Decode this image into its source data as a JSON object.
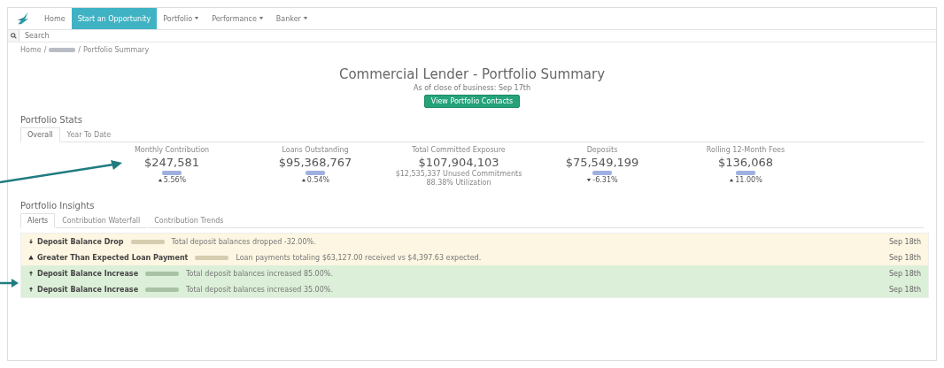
{
  "nav": {
    "items": [
      {
        "label": "Home",
        "selected": false,
        "dropdown": false
      },
      {
        "label": "Start an Opportunity",
        "selected": true,
        "dropdown": false
      },
      {
        "label": "Portfolio",
        "selected": false,
        "dropdown": true
      },
      {
        "label": "Performance",
        "selected": false,
        "dropdown": true
      },
      {
        "label": "Banker",
        "selected": false,
        "dropdown": true
      }
    ]
  },
  "search": {
    "placeholder": "Search"
  },
  "breadcrumb": {
    "first": "Home",
    "separator": "/",
    "last": "Portfolio Summary"
  },
  "header": {
    "title": "Commercial Lender - Portfolio Summary",
    "subtitle": "As of close of business: Sep 17th",
    "button": "View Portfolio Contacts"
  },
  "stats": {
    "heading": "Portfolio Stats",
    "tabs": [
      {
        "label": "Overall",
        "selected": true
      },
      {
        "label": "Year To Date",
        "selected": false
      }
    ],
    "items": [
      {
        "label": "Monthly Contribution",
        "value": "$247,581",
        "kind": "up",
        "change": "5.56%"
      },
      {
        "label": "Loans Outstanding",
        "value": "$95,368,767",
        "kind": "up",
        "change": "0.54%"
      },
      {
        "label": "Total Committed Exposure",
        "value": "$107,904,103",
        "kind": "notes",
        "notes": [
          "$12,535,337 Unused Commitments",
          "88.38% Utilization"
        ]
      },
      {
        "label": "Deposits",
        "value": "$75,549,199",
        "kind": "down",
        "change": "-6.31%"
      },
      {
        "label": "Rolling 12-Month Fees",
        "value": "$136,068",
        "kind": "up",
        "change": "11.00%"
      }
    ]
  },
  "insights": {
    "heading": "Portfolio Insights",
    "tabs": [
      {
        "label": "Alerts",
        "selected": true
      },
      {
        "label": "Contribution Waterfall",
        "selected": false
      },
      {
        "label": "Contribution Trends",
        "selected": false
      }
    ],
    "alerts": [
      {
        "kind": "drop",
        "title": "Deposit Balance Drop",
        "message": "Total deposit balances dropped -32.00%.",
        "date": "Sep 18th"
      },
      {
        "kind": "payment",
        "title": "Greater Than Expected Loan Payment",
        "message": "Loan payments totaling $63,127.00 received vs $4,397.63 expected.",
        "date": "Sep 18th"
      },
      {
        "kind": "increase",
        "title": "Deposit Balance Increase",
        "message": "Total deposit balances increased 85.00%.",
        "date": "Sep 18th"
      },
      {
        "kind": "increase",
        "title": "Deposit Balance Increase",
        "message": "Total deposit balances increased 35.00%.",
        "date": "Sep 18th"
      }
    ]
  }
}
